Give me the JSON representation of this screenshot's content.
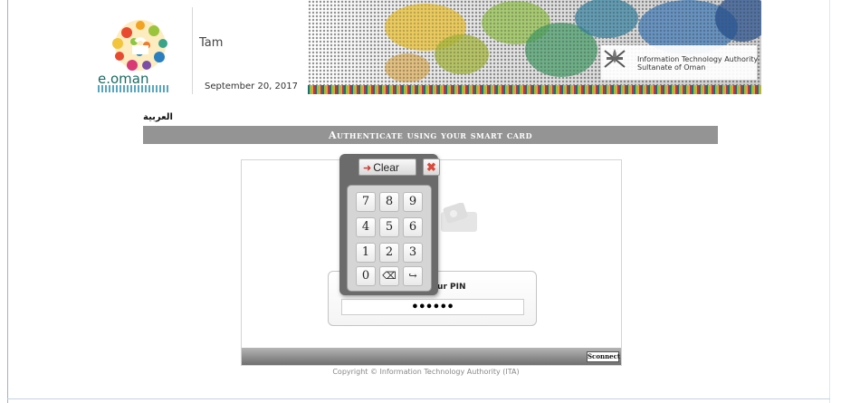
{
  "header": {
    "logo_text": "e.oman",
    "user_name": "Tam",
    "date": "September 20, 2017",
    "ita_line1": "Information Technology Authority",
    "ita_line2": "Sultanate of Oman"
  },
  "language_link": "العربية",
  "title": "Authenticate using your smart card",
  "pin": {
    "label": "Enter your PIN",
    "value": "••••••"
  },
  "keypad": {
    "clear_label": "Clear",
    "close_label": "✖",
    "keys": [
      "7",
      "8",
      "9",
      "4",
      "5",
      "6",
      "1",
      "2",
      "3",
      "0",
      "⌫",
      "↪"
    ]
  },
  "connect_label": "Sconnect",
  "copyright": "Copyright © Information Technology Authority (ITA)",
  "colors": {
    "title_bar": "#949494",
    "keypad_bg": "#6b6b6b",
    "logo_text": "#1a6b63"
  },
  "icons": {
    "close": "red-x-icon",
    "clear": "red-arrow-icon",
    "backspace": "backspace-icon",
    "enter": "enter-icon"
  }
}
